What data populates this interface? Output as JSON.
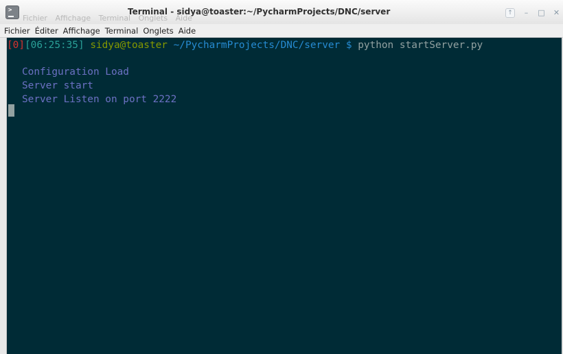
{
  "window": {
    "title": "Terminal - sidya@toaster:~/PycharmProjects/DNC/server",
    "ghost_menu": [
      "Fichier",
      "Affichage",
      "Terminal",
      "Onglets",
      "Aide"
    ],
    "icon": "terminal-app-icon",
    "controls": {
      "up": "↑",
      "minimize": "–",
      "maximize": "□",
      "close": "✕"
    }
  },
  "menubar": {
    "items": [
      "Fichier",
      "Éditer",
      "Affichage",
      "Terminal",
      "Onglets",
      "Aide"
    ]
  },
  "terminal": {
    "prompt": {
      "index": "[0]",
      "time": "[06:25:35]",
      "user_host": "sidya@toaster",
      "path": "~/PycharmProjects/DNC/server",
      "symbol": "$",
      "command": "python startServer.py"
    },
    "output": [
      "Configuration Load",
      "Server start",
      "Server Listen on port 2222"
    ]
  },
  "colors": {
    "terminal_bg": "#002b36",
    "prompt_index": "#dc322f",
    "prompt_time": "#2aa198",
    "user_host": "#859900",
    "path": "#268bd2",
    "output_text": "#6c71c4"
  }
}
